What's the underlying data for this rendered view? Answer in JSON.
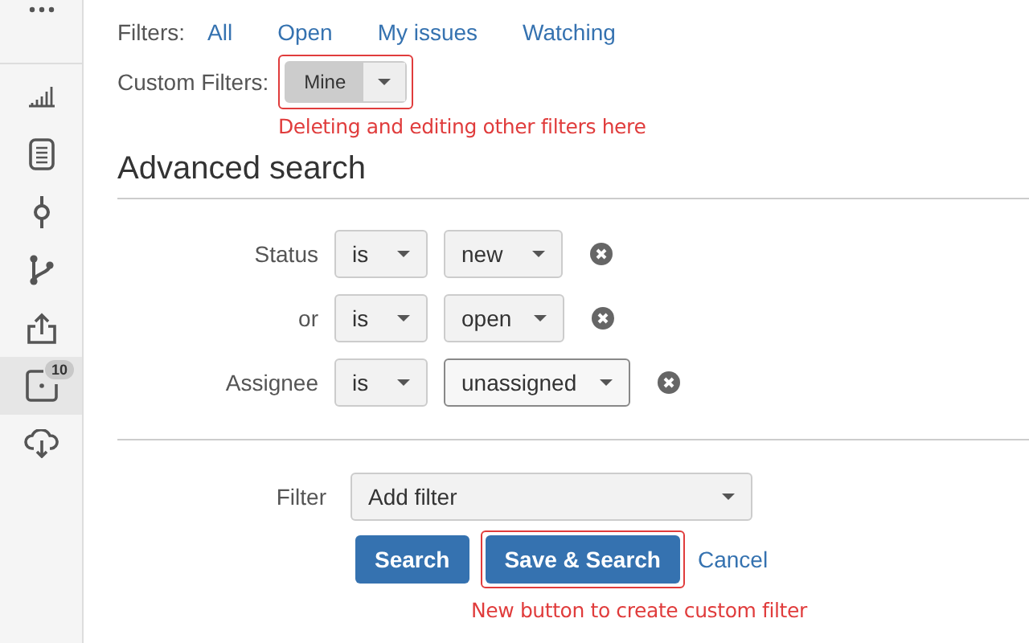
{
  "sidebar": {
    "items": [
      {
        "kind": "more",
        "selected": false
      },
      {
        "kind": "chart",
        "selected": false
      },
      {
        "kind": "document",
        "selected": false
      },
      {
        "kind": "commit",
        "selected": false
      },
      {
        "kind": "branch",
        "selected": false
      },
      {
        "kind": "upload",
        "selected": false
      },
      {
        "kind": "issues",
        "selected": true,
        "badge": "10"
      },
      {
        "kind": "cloud",
        "selected": false
      }
    ]
  },
  "filters": {
    "label": "Filters:",
    "links": [
      "All",
      "Open",
      "My issues",
      "Watching"
    ]
  },
  "custom_filters": {
    "label": "Custom Filters:",
    "value": "Mine",
    "highlighted": true,
    "note": "Deleting and editing other filters here"
  },
  "advanced_search": {
    "title": "Advanced search",
    "conditions": [
      {
        "label": "Status",
        "operator": "is",
        "value": "new",
        "focused": false
      },
      {
        "label": "or",
        "operator": "is",
        "value": "open",
        "focused": false
      },
      {
        "label": "Assignee",
        "operator": "is",
        "value": "unassigned",
        "focused": true
      }
    ],
    "filter": {
      "label": "Filter",
      "value": "Add filter"
    },
    "buttons": [
      {
        "label": "Search",
        "kind": "primary",
        "highlighted": false
      },
      {
        "label": "Save & Search",
        "kind": "primary",
        "highlighted": true
      },
      {
        "label": "Cancel",
        "kind": "link",
        "highlighted": false
      }
    ],
    "note": "New button to create custom filter"
  }
}
